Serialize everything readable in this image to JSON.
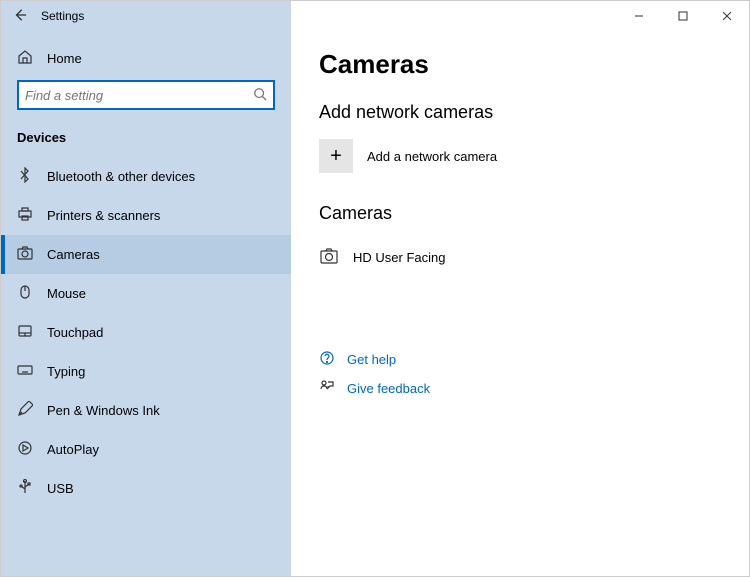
{
  "window": {
    "title": "Settings"
  },
  "sidebar": {
    "home_label": "Home",
    "search_placeholder": "Find a setting",
    "section_label": "Devices",
    "items": [
      {
        "label": "Bluetooth & other devices"
      },
      {
        "label": "Printers & scanners"
      },
      {
        "label": "Cameras"
      },
      {
        "label": "Mouse"
      },
      {
        "label": "Touchpad"
      },
      {
        "label": "Typing"
      },
      {
        "label": "Pen & Windows Ink"
      },
      {
        "label": "AutoPlay"
      },
      {
        "label": "USB"
      }
    ],
    "selected_index": 2
  },
  "main": {
    "page_title": "Cameras",
    "add_section_title": "Add network cameras",
    "add_button_label": "Add a network camera",
    "list_section_title": "Cameras",
    "devices": [
      {
        "name": "HD User Facing"
      }
    ],
    "help": {
      "get_help": "Get help",
      "feedback": "Give feedback"
    }
  }
}
